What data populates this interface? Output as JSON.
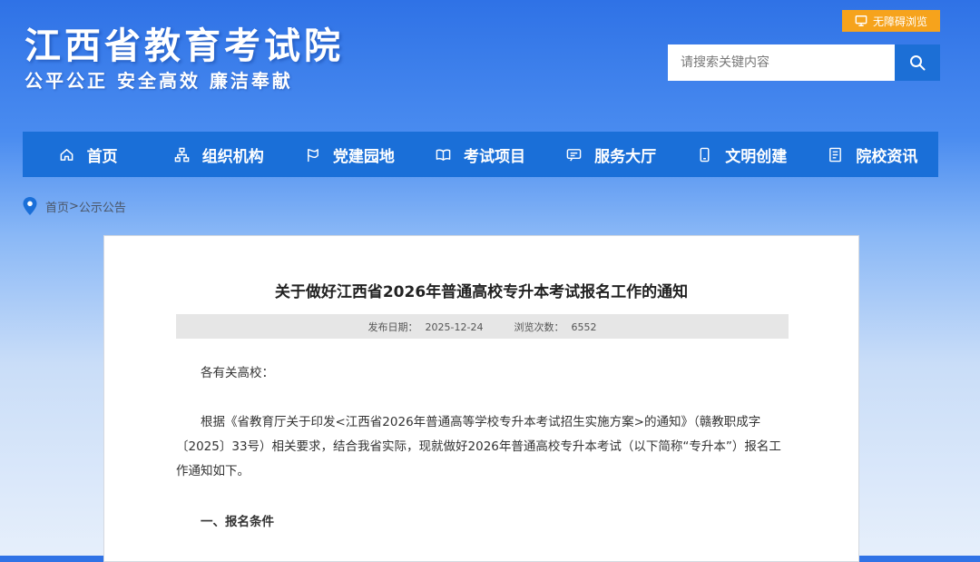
{
  "header": {
    "site_title": "江西省教育考试院",
    "site_motto": "公平公正  安全高效  廉洁奉献",
    "accessibility_label": "无障碍浏览"
  },
  "search": {
    "placeholder": "请搜索关键内容"
  },
  "nav": {
    "items": [
      {
        "label": "首页",
        "icon": "home-icon"
      },
      {
        "label": "组织机构",
        "icon": "org-chart-icon"
      },
      {
        "label": "党建园地",
        "icon": "party-icon"
      },
      {
        "label": "考试项目",
        "icon": "book-icon"
      },
      {
        "label": "服务大厅",
        "icon": "service-icon"
      },
      {
        "label": "文明创建",
        "icon": "mobile-icon"
      },
      {
        "label": "院校资讯",
        "icon": "document-icon"
      }
    ]
  },
  "breadcrumb": {
    "home": "首页",
    "separator": ">",
    "current": "公示公告"
  },
  "article": {
    "title": "关于做好江西省2026年普通高校专升本考试报名工作的通知",
    "publish_label": "发布日期：",
    "publish_date": "2025-12-24",
    "views_label": "浏览次数：",
    "views": "6552",
    "salutation": "各有关高校：",
    "paragraph1": "根据《省教育厅关于印发<江西省2026年普通高等学校专升本考试招生实施方案>的通知》（赣教职成字〔2025〕33号）相关要求，结合我省实际，现就做好2026年普通高校专升本考试（以下简称“专升本”）报名工作通知如下。",
    "section1": "一、报名条件"
  },
  "colors": {
    "nav_bg": "#1a6fd8",
    "accessibility_bg": "#f6a31c",
    "search_button": "#1c6fd6"
  }
}
